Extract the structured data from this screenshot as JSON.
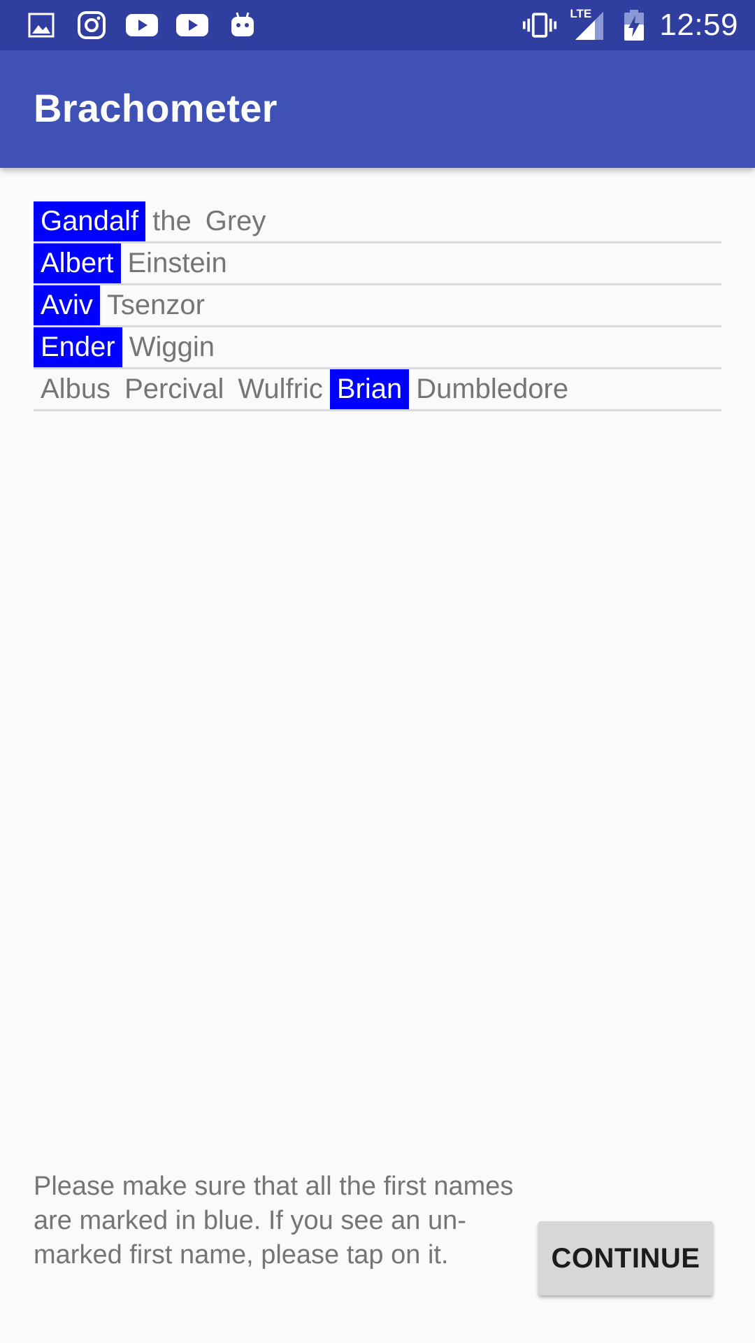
{
  "status_bar": {
    "left_icons": [
      "gallery-icon",
      "instagram-icon",
      "youtube-icon",
      "youtube-icon",
      "android-icon"
    ],
    "right_icons": [
      "vibrate-icon",
      "lte-signal-icon",
      "battery-charging-icon"
    ],
    "lte_label": "LTE",
    "time": "12:59"
  },
  "app_bar": {
    "title": "Brachometer"
  },
  "names": [
    {
      "words": [
        {
          "text": "Gandalf",
          "marked": true
        },
        {
          "text": "the",
          "marked": false
        },
        {
          "text": "Grey",
          "marked": false
        }
      ]
    },
    {
      "words": [
        {
          "text": "Albert",
          "marked": true
        },
        {
          "text": "Einstein",
          "marked": false
        }
      ]
    },
    {
      "words": [
        {
          "text": "Aviv",
          "marked": true
        },
        {
          "text": "Tsenzor",
          "marked": false
        }
      ]
    },
    {
      "words": [
        {
          "text": "Ender",
          "marked": true
        },
        {
          "text": "Wiggin",
          "marked": false
        }
      ]
    },
    {
      "words": [
        {
          "text": "Albus",
          "marked": false
        },
        {
          "text": "Percival",
          "marked": false
        },
        {
          "text": "Wulfric",
          "marked": false
        },
        {
          "text": "Brian",
          "marked": true
        },
        {
          "text": "Dumbledore",
          "marked": false
        }
      ]
    }
  ],
  "instructions": "Please make sure that all the first names are marked in blue. If you see an un-marked first name, please tap on it.",
  "continue_button": {
    "label": "CONTINUE"
  },
  "colors": {
    "status_bar": "#303f9f",
    "app_bar": "#3f51b5",
    "marked_background": "#0000ff",
    "marked_text": "#ffffff",
    "unmarked_text": "#757575",
    "button_background": "#d6d7d7"
  }
}
